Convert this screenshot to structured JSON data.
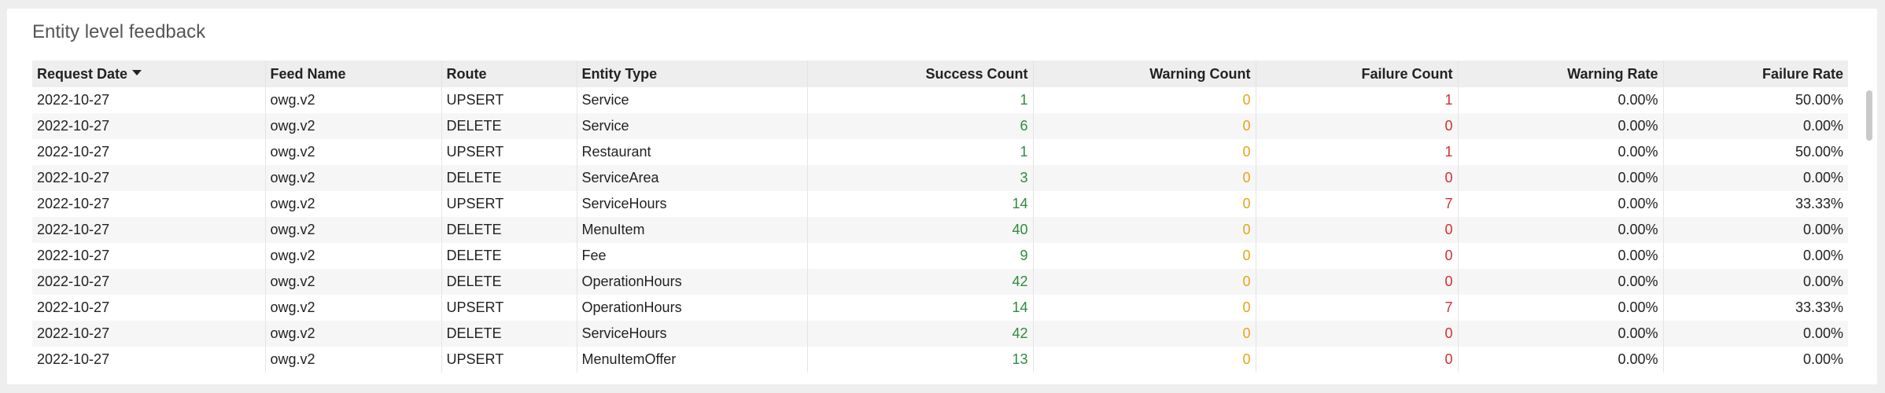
{
  "panel": {
    "title": "Entity level feedback"
  },
  "colors": {
    "success": "#2e8b3e",
    "warning": "#e8a317",
    "failure": "#d32f2f"
  },
  "table": {
    "sort_icon": "caret-down-icon",
    "columns": [
      {
        "label": "Request Date",
        "numeric": false
      },
      {
        "label": "Feed Name",
        "numeric": false
      },
      {
        "label": "Route",
        "numeric": false
      },
      {
        "label": "Entity Type",
        "numeric": false
      },
      {
        "label": "Success Count",
        "numeric": true
      },
      {
        "label": "Warning Count",
        "numeric": true
      },
      {
        "label": "Failure Count",
        "numeric": true
      },
      {
        "label": "Warning Rate",
        "numeric": true
      },
      {
        "label": "Failure Rate",
        "numeric": true
      }
    ],
    "rows": [
      [
        "2022-10-27",
        "owg.v2",
        "UPSERT",
        "Service",
        "1",
        "0",
        "1",
        "0.00%",
        "50.00%"
      ],
      [
        "2022-10-27",
        "owg.v2",
        "DELETE",
        "Service",
        "6",
        "0",
        "0",
        "0.00%",
        "0.00%"
      ],
      [
        "2022-10-27",
        "owg.v2",
        "UPSERT",
        "Restaurant",
        "1",
        "0",
        "1",
        "0.00%",
        "50.00%"
      ],
      [
        "2022-10-27",
        "owg.v2",
        "DELETE",
        "ServiceArea",
        "3",
        "0",
        "0",
        "0.00%",
        "0.00%"
      ],
      [
        "2022-10-27",
        "owg.v2",
        "UPSERT",
        "ServiceHours",
        "14",
        "0",
        "7",
        "0.00%",
        "33.33%"
      ],
      [
        "2022-10-27",
        "owg.v2",
        "DELETE",
        "MenuItem",
        "40",
        "0",
        "0",
        "0.00%",
        "0.00%"
      ],
      [
        "2022-10-27",
        "owg.v2",
        "DELETE",
        "Fee",
        "9",
        "0",
        "0",
        "0.00%",
        "0.00%"
      ],
      [
        "2022-10-27",
        "owg.v2",
        "DELETE",
        "OperationHours",
        "42",
        "0",
        "0",
        "0.00%",
        "0.00%"
      ],
      [
        "2022-10-27",
        "owg.v2",
        "UPSERT",
        "OperationHours",
        "14",
        "0",
        "7",
        "0.00%",
        "33.33%"
      ],
      [
        "2022-10-27",
        "owg.v2",
        "DELETE",
        "ServiceHours",
        "42",
        "0",
        "0",
        "0.00%",
        "0.00%"
      ],
      [
        "2022-10-27",
        "owg.v2",
        "UPSERT",
        "MenuItemOffer",
        "13",
        "0",
        "0",
        "0.00%",
        "0.00%"
      ]
    ]
  }
}
